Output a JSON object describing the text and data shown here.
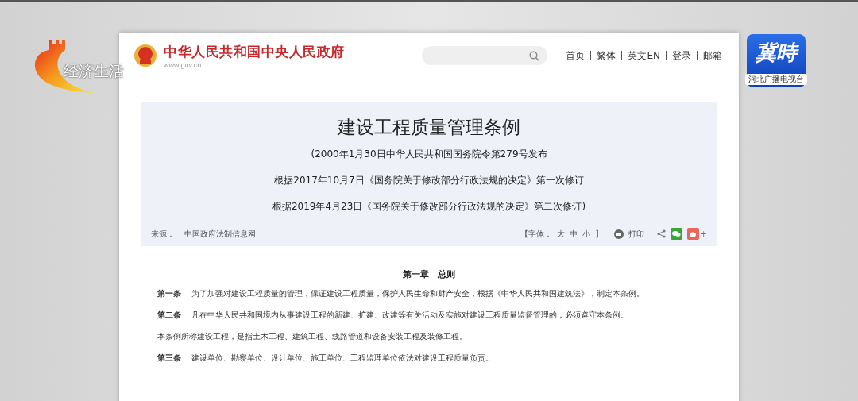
{
  "channel_logo": {
    "text": "经济生活"
  },
  "app_logo": {
    "title": "冀時",
    "subtitle": "河北广播电视台"
  },
  "site": {
    "name": "中华人民共和国中央人民政府",
    "domain": "www.gov.cn",
    "nav": [
      "首页",
      "繁体",
      "英文EN",
      "登录",
      "邮箱"
    ]
  },
  "document": {
    "title": "建设工程质量管理条例",
    "notes": [
      "(2000年1月30日中华人民共和国国务院令第279号发布",
      "根据2017年10月7日《国务院关于修改部分行政法规的决定》第一次修订",
      "根据2019年4月23日《国务院关于修改部分行政法规的决定》第二次修订)"
    ],
    "source_label": "来源：",
    "source": "中国政府法制信息网",
    "font_size": {
      "open": "【字体：",
      "options": [
        "大",
        "中",
        "小"
      ],
      "close": "】"
    },
    "print": "打印",
    "more": "+"
  },
  "chapter": "第一章　总则",
  "articles": [
    {
      "number": "第一条",
      "text": "为了加强对建设工程质量的管理，保证建设工程质量，保护人民生命和财产安全，根据《中华人民共和国建筑法》，制定本条例。"
    },
    {
      "number": "第二条",
      "text": "凡在中华人民共和国境内从事建设工程的新建、扩建、改建等有关活动及实施对建设工程质量监督管理的，必须遵守本条例。"
    },
    {
      "text": "本条例所称建设工程，是指土木工程、建筑工程、线路管道和设备安装工程及装修工程。"
    },
    {
      "number": "第三条",
      "text": "建设单位、勘察单位、设计单位、施工单位、工程监理单位依法对建设工程质量负责。"
    }
  ]
}
